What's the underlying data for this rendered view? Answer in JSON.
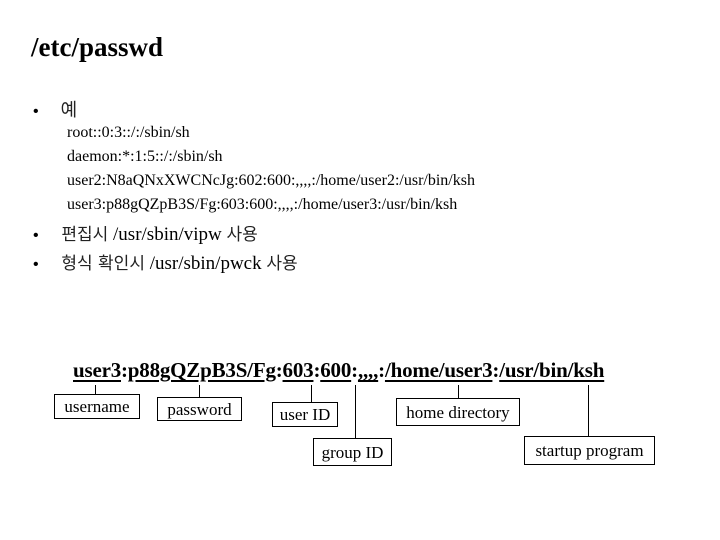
{
  "slide": {
    "title": "/etc/passwd",
    "bullets": [
      {
        "marker": "•",
        "text": "예"
      },
      {
        "marker": "•",
        "text_ko_1": "편집시",
        "text_path": "/usr/sbin/vipw",
        "text_ko_2": "사용"
      },
      {
        "marker": "•",
        "text_ko_1": "형식 확인시",
        "text_path": "/usr/sbin/pwck",
        "text_ko_2": "사용"
      }
    ],
    "example_lines": [
      "root::0:3::/:/sbin/sh",
      "daemon:*:1:5::/:/sbin/sh",
      "user2:N8aQNxXWCNcJg:602:600:,,,,:/home/user2:/usr/bin/ksh",
      "user3:p88gQZpB3S/Fg:603:600:,,,,:/home/user3:/usr/bin/ksh"
    ]
  },
  "diagram": {
    "record_fields": {
      "username": "user3",
      "sep1": ":",
      "password": "p88gQZpB3S/Fg",
      "sep2": ":",
      "uid": "603",
      "sep3": ":",
      "gid": "600",
      "sep4": ":",
      "gecos": ",,,,",
      "sep5": ":",
      "home": "/home/user3",
      "sep6": ":",
      "shell": "/usr/bin/ksh"
    },
    "labels": {
      "username": "username",
      "password": "password",
      "uid": "user ID",
      "gid": "group ID",
      "home": "home directory",
      "shell": "startup program"
    }
  }
}
